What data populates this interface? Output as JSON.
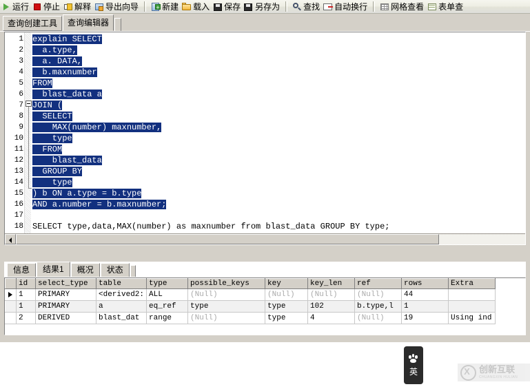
{
  "toolbar": {
    "groups": [
      {
        "items": [
          {
            "icon": "run-icon",
            "label": "运行"
          },
          {
            "icon": "stop-icon",
            "label": "停止"
          },
          {
            "icon": "explain-icon",
            "label": "解释"
          },
          {
            "icon": "export-wizard-icon",
            "label": "导出向导"
          }
        ]
      },
      {
        "items": [
          {
            "icon": "new-icon",
            "label": "新建"
          },
          {
            "icon": "load-icon",
            "label": "载入"
          },
          {
            "icon": "save-icon",
            "label": "保存"
          },
          {
            "icon": "save-as-icon",
            "label": "另存为"
          }
        ]
      },
      {
        "items": [
          {
            "icon": "find-icon",
            "label": "查找"
          },
          {
            "icon": "auto-wrap-icon",
            "label": "自动换行"
          }
        ]
      },
      {
        "items": [
          {
            "icon": "grid-view-icon",
            "label": "网格查看"
          },
          {
            "icon": "form-view-icon",
            "label": "表单查"
          }
        ]
      }
    ]
  },
  "top_tabs": {
    "items": [
      {
        "label": "查询创建工具",
        "active": false
      },
      {
        "label": "查询编辑器",
        "active": true
      }
    ]
  },
  "editor": {
    "line_numbers": [
      "1",
      "2",
      "3",
      "4",
      "5",
      "6",
      "7",
      "8",
      "9",
      "10",
      "11",
      "12",
      "13",
      "14",
      "15",
      "16",
      "17",
      "18"
    ],
    "lines": [
      {
        "n": 1,
        "text": "explain SELECT",
        "selected": true
      },
      {
        "n": 2,
        "text": "  a.type,",
        "selected": true
      },
      {
        "n": 3,
        "text": "  a. DATA,",
        "selected": true
      },
      {
        "n": 4,
        "text": "  b.maxnumber",
        "selected": true
      },
      {
        "n": 5,
        "text": "FROM",
        "selected": true
      },
      {
        "n": 6,
        "text": "  blast_data a",
        "selected": true
      },
      {
        "n": 7,
        "text": "JOIN (",
        "selected": true
      },
      {
        "n": 8,
        "text": "  SELECT",
        "selected": true
      },
      {
        "n": 9,
        "text": "    MAX(number) maxnumber,",
        "selected": true
      },
      {
        "n": 10,
        "text": "    type",
        "selected": true
      },
      {
        "n": 11,
        "text": "  FROM",
        "selected": true
      },
      {
        "n": 12,
        "text": "    blast_data",
        "selected": true
      },
      {
        "n": 13,
        "text": "  GROUP BY",
        "selected": true
      },
      {
        "n": 14,
        "text": "    type",
        "selected": true
      },
      {
        "n": 15,
        "text": ") b ON a.type = b.type",
        "selected": true
      },
      {
        "n": 16,
        "text": "AND a.number = b.maxnumber;",
        "selected": true
      },
      {
        "n": 17,
        "text": "",
        "selected": false
      },
      {
        "n": 18,
        "text": "SELECT type,data,MAX(number) as maxnumber from blast_data GROUP BY type;",
        "selected": false
      }
    ],
    "selection_color": "#12307f"
  },
  "result_tabs": {
    "items": [
      {
        "label": "信息",
        "active": false
      },
      {
        "label": "结果1",
        "active": true
      },
      {
        "label": "概况",
        "active": false
      },
      {
        "label": "状态",
        "active": false
      }
    ]
  },
  "result_grid": {
    "columns": [
      "id",
      "select_type",
      "table",
      "type",
      "possible_keys",
      "key",
      "key_len",
      "ref",
      "rows",
      "Extra"
    ],
    "rows": [
      {
        "current": true,
        "cells": [
          "1",
          "PRIMARY",
          "<derived2:",
          "ALL",
          "(Null)",
          "(Null)",
          "(Null)",
          "(Null)",
          "44",
          ""
        ]
      },
      {
        "current": false,
        "cells": [
          "1",
          "PRIMARY",
          "a",
          "eq_ref",
          "type",
          "type",
          "102",
          "b.type,l",
          "1",
          ""
        ]
      },
      {
        "current": false,
        "cells": [
          "2",
          "DERIVED",
          "blast_dat",
          "range",
          "(Null)",
          "type",
          "4",
          "(Null)",
          "19",
          "Using ind"
        ]
      }
    ],
    "null_text": "(Null)"
  },
  "ime": {
    "icon": "baidu-paw-icon",
    "mode": "英"
  },
  "watermark": {
    "icon": "cx-logo-icon",
    "text_cn": "创新互联",
    "text_en": "CHUANGXIN HULIAN"
  }
}
